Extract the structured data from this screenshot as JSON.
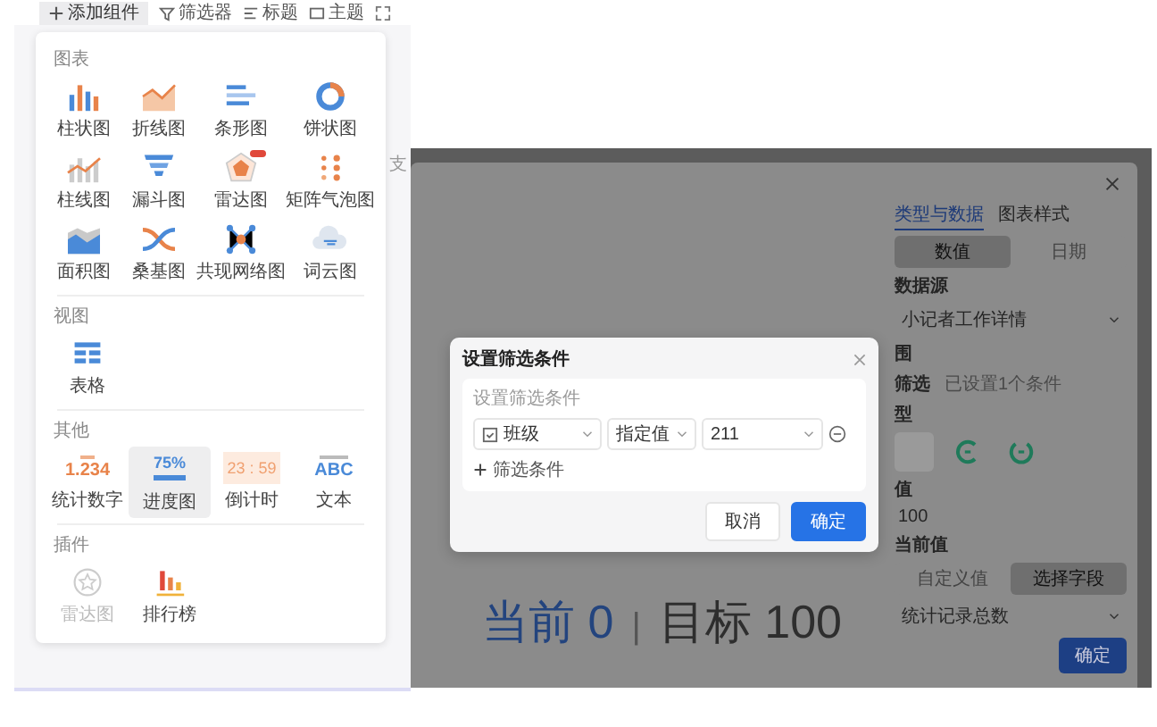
{
  "toolbar": {
    "add_button": "添加组件",
    "items": [
      {
        "label": "筛选器"
      },
      {
        "label": "标题"
      },
      {
        "label": "主题"
      }
    ]
  },
  "component_panel": {
    "sections": [
      {
        "title": "图表",
        "items": [
          {
            "label": "柱状图",
            "kind": "bar",
            "selected": false,
            "disabled": false,
            "badge": false
          },
          {
            "label": "折线图",
            "kind": "line",
            "selected": false,
            "disabled": false,
            "badge": false
          },
          {
            "label": "条形图",
            "kind": "hbar",
            "selected": false,
            "disabled": false,
            "badge": false
          },
          {
            "label": "饼状图",
            "kind": "donut",
            "selected": false,
            "disabled": false,
            "badge": false
          },
          {
            "label": "柱线图",
            "kind": "barline",
            "selected": false,
            "disabled": false,
            "badge": false
          },
          {
            "label": "漏斗图",
            "kind": "funnel",
            "selected": false,
            "disabled": false,
            "badge": false
          },
          {
            "label": "雷达图",
            "kind": "radar",
            "selected": false,
            "disabled": false,
            "badge": true
          },
          {
            "label": "矩阵气泡图",
            "kind": "matrix",
            "selected": false,
            "disabled": false,
            "badge": false
          },
          {
            "label": "面积图",
            "kind": "area",
            "selected": false,
            "disabled": false,
            "badge": false
          },
          {
            "label": "桑基图",
            "kind": "sankey",
            "selected": false,
            "disabled": false,
            "badge": false
          },
          {
            "label": "共现网络图",
            "kind": "network",
            "selected": false,
            "disabled": false,
            "badge": false
          },
          {
            "label": "词云图",
            "kind": "wordcloud",
            "selected": false,
            "disabled": false,
            "badge": false
          }
        ]
      },
      {
        "title": "视图",
        "items": [
          {
            "label": "表格",
            "kind": "table",
            "selected": false,
            "disabled": false,
            "badge": false
          }
        ]
      },
      {
        "title": "其他",
        "items": [
          {
            "label": "统计数字",
            "kind": "number",
            "icon_text": "1.234",
            "selected": false,
            "disabled": false,
            "badge": false
          },
          {
            "label": "进度图",
            "kind": "progress",
            "icon_text": "75%",
            "selected": true,
            "disabled": false,
            "badge": false
          },
          {
            "label": "倒计时",
            "kind": "countdown",
            "icon_text": "23 : 59",
            "selected": false,
            "disabled": false,
            "badge": false
          },
          {
            "label": "文本",
            "kind": "text",
            "icon_text": "ABC",
            "selected": false,
            "disabled": false,
            "badge": false
          }
        ]
      },
      {
        "title": "插件",
        "items": [
          {
            "label": "雷达图",
            "kind": "plugin",
            "selected": false,
            "disabled": true,
            "badge": false
          },
          {
            "label": "排行榜",
            "kind": "ranking",
            "selected": false,
            "disabled": false,
            "badge": false
          }
        ]
      }
    ]
  },
  "cut_text": "支",
  "drawer": {
    "current_text": "当前 0",
    "separator": "|",
    "target_text": "目标 100",
    "tabs": [
      {
        "label": "类型与数据",
        "selected": true
      },
      {
        "label": "图表样式",
        "selected": false
      }
    ],
    "value_type": [
      {
        "label": "数值",
        "selected": true
      },
      {
        "label": "日期",
        "selected": false
      }
    ],
    "source_label": "数据源",
    "source_value": "小记者工作详情",
    "filter_label": "围",
    "filter_mode": "筛选",
    "filter_summary": "已设置1个条件",
    "style_label": "型",
    "styles": [
      {
        "kind": "box",
        "selected": true
      },
      {
        "kind": "gauge-open",
        "selected": false
      },
      {
        "kind": "gauge-ring",
        "selected": false
      }
    ],
    "target_label": "值",
    "target_value": "100",
    "current_label": "当前值",
    "current_mode": [
      {
        "label": "自定义值",
        "selected": false
      },
      {
        "label": "选择字段",
        "selected": true
      }
    ],
    "current_field": "统计记录总数",
    "confirm": "确定"
  },
  "dialog": {
    "title": "设置筛选条件",
    "section_label": "设置筛选条件",
    "condition": {
      "field": "班级",
      "operator": "指定值",
      "value": "211"
    },
    "add_label": "筛选条件",
    "buttons": [
      {
        "label": "取消",
        "primary": false
      },
      {
        "label": "确定",
        "primary": true
      }
    ]
  }
}
